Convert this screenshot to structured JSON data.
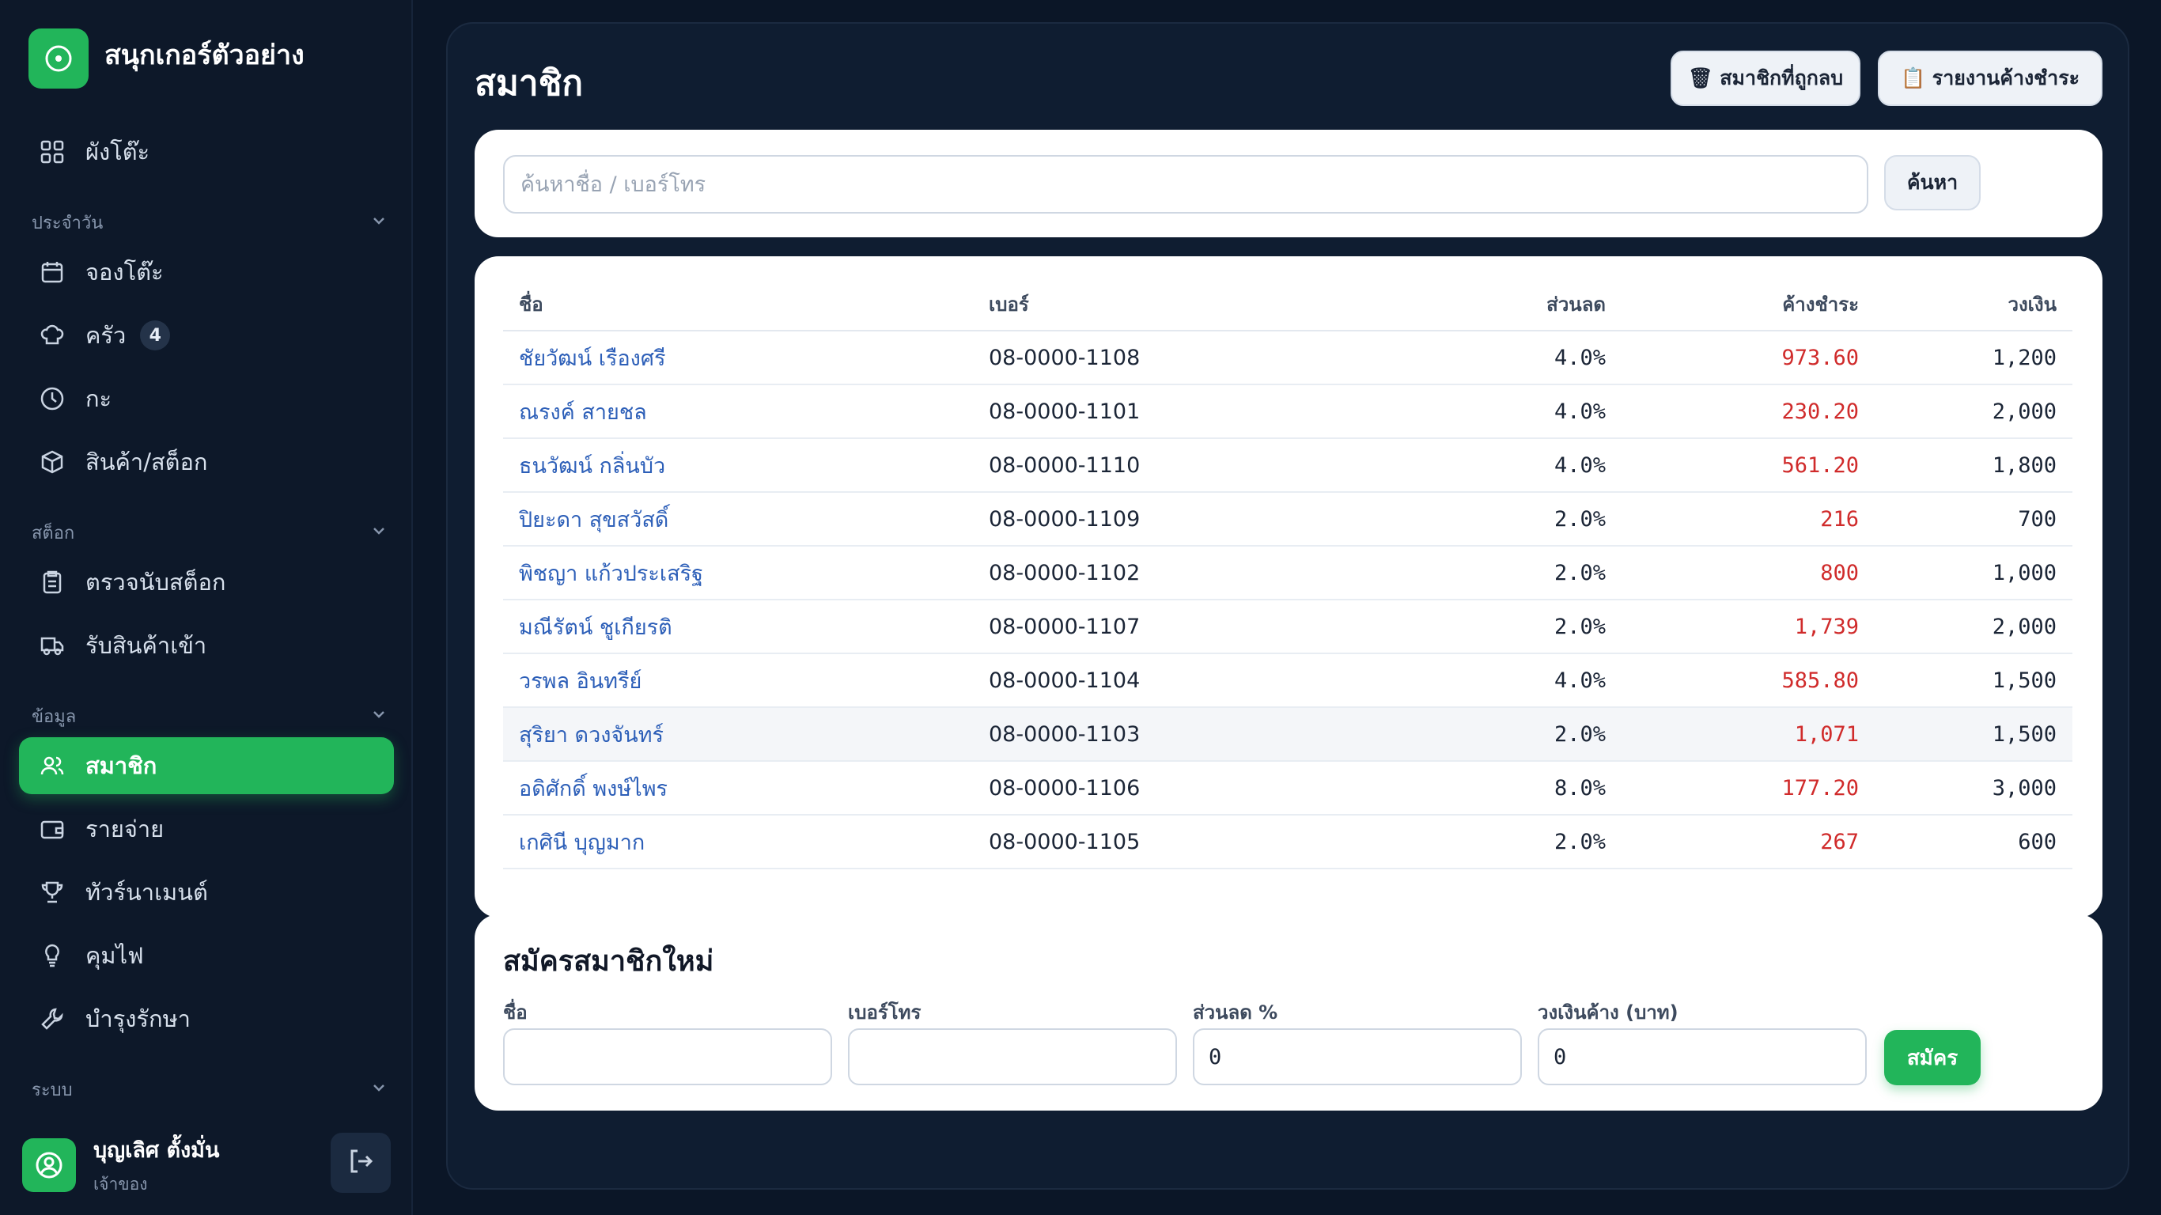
{
  "app": {
    "title": "สนุกเกอร์ตัวอย่าง"
  },
  "sidebar": {
    "top": [
      {
        "label": "ผังโต๊ะ",
        "icon": "grid-icon"
      }
    ],
    "sections": [
      {
        "label": "ประจำวัน",
        "items": [
          {
            "label": "จองโต๊ะ",
            "icon": "calendar-icon"
          },
          {
            "label": "ครัว",
            "icon": "chef-hat-icon",
            "badge": "4"
          },
          {
            "label": "กะ",
            "icon": "clock-icon"
          },
          {
            "label": "สินค้า/สต็อก",
            "icon": "box-icon"
          }
        ]
      },
      {
        "label": "สต็อก",
        "items": [
          {
            "label": "ตรวจนับสต็อก",
            "icon": "clipboard-icon"
          },
          {
            "label": "รับสินค้าเข้า",
            "icon": "truck-icon"
          }
        ]
      },
      {
        "label": "ข้อมูล",
        "items": [
          {
            "label": "สมาชิก",
            "icon": "users-icon",
            "active": true
          },
          {
            "label": "รายจ่าย",
            "icon": "wallet-icon"
          },
          {
            "label": "ทัวร์นาเมนต์",
            "icon": "trophy-icon"
          },
          {
            "label": "คุมไฟ",
            "icon": "bulb-icon"
          },
          {
            "label": "บำรุงรักษา",
            "icon": "wrench-icon"
          }
        ]
      },
      {
        "label": "ระบบ",
        "items": []
      }
    ],
    "user": {
      "name": "บุญเลิศ ตั้งมั่น",
      "role": "เจ้าของ"
    }
  },
  "main": {
    "title": "สมาชิก",
    "buttons": {
      "deleted": "🗑 สมาชิกที่ถูกลบ",
      "report": "📋 รายงานค้างชำระ"
    },
    "search": {
      "placeholder": "ค้นหาชื่อ / เบอร์โทร",
      "button": "ค้นหา"
    },
    "table": {
      "headers": {
        "name": "ชื่อ",
        "phone": "เบอร์",
        "discount": "ส่วนลด",
        "owed": "ค้างชำระ",
        "limit": "วงเงิน"
      },
      "rows": [
        {
          "name": "ชัยวัฒน์ เรืองศรี",
          "phone": "08-0000-1108",
          "discount": "4.0%",
          "owed": "973.60",
          "limit": "1,200"
        },
        {
          "name": "ณรงค์ สายชล",
          "phone": "08-0000-1101",
          "discount": "4.0%",
          "owed": "230.20",
          "limit": "2,000"
        },
        {
          "name": "ธนวัฒน์ กลิ่นบัว",
          "phone": "08-0000-1110",
          "discount": "4.0%",
          "owed": "561.20",
          "limit": "1,800"
        },
        {
          "name": "ปิยะดา สุขสวัสดิ์",
          "phone": "08-0000-1109",
          "discount": "2.0%",
          "owed": "216",
          "limit": "700"
        },
        {
          "name": "พิชญา แก้วประเสริฐ",
          "phone": "08-0000-1102",
          "discount": "2.0%",
          "owed": "800",
          "limit": "1,000"
        },
        {
          "name": "มณีรัตน์ ชูเกียรติ",
          "phone": "08-0000-1107",
          "discount": "2.0%",
          "owed": "1,739",
          "limit": "2,000"
        },
        {
          "name": "วรพล อินทรีย์",
          "phone": "08-0000-1104",
          "discount": "4.0%",
          "owed": "585.80",
          "limit": "1,500"
        },
        {
          "name": "สุริยา ดวงจันทร์",
          "phone": "08-0000-1103",
          "discount": "2.0%",
          "owed": "1,071",
          "limit": "1,500"
        },
        {
          "name": "อดิศักดิ์ พงษ์ไพร",
          "phone": "08-0000-1106",
          "discount": "8.0%",
          "owed": "177.20",
          "limit": "3,000"
        },
        {
          "name": "เกศินี บุญมาก",
          "phone": "08-0000-1105",
          "discount": "2.0%",
          "owed": "267",
          "limit": "600"
        }
      ]
    },
    "form": {
      "title": "สมัครสมาชิกใหม่",
      "name_label": "ชื่อ",
      "name_value": "",
      "phone_label": "เบอร์โทร",
      "phone_value": "",
      "discount_label": "ส่วนลด %",
      "discount_value": "0",
      "limit_label": "วงเงินค้าง (บาท)",
      "limit_value": "0",
      "submit": "สมัคร"
    }
  },
  "colors": {
    "accent": "#22b55a",
    "owed": "#d02b2b",
    "link": "#2d5fb8",
    "background": "#0b1627"
  }
}
